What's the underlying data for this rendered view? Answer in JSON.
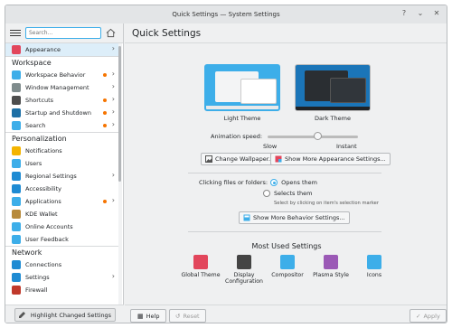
{
  "window": {
    "title": "Quick Settings — System Settings"
  },
  "toolbar": {
    "search_placeholder": "Search..."
  },
  "sidebar": {
    "items": [
      {
        "type": "item",
        "label": "Appearance",
        "icon": "appearance-icon",
        "color": "#e2465c",
        "chevron": true,
        "dot": false
      },
      {
        "type": "section",
        "label": "Workspace"
      },
      {
        "type": "item",
        "label": "Workspace Behavior",
        "icon": "workspace-icon",
        "color": "#3daee9",
        "chevron": true,
        "dot": true
      },
      {
        "type": "item",
        "label": "Window Management",
        "icon": "window-icon",
        "color": "#7f8c8d",
        "chevron": true,
        "dot": false
      },
      {
        "type": "item",
        "label": "Shortcuts",
        "icon": "keyboard-icon",
        "color": "#4d4d4d",
        "chevron": true,
        "dot": true
      },
      {
        "type": "item",
        "label": "Startup and Shutdown",
        "icon": "startup-icon",
        "color": "#1d6fa5",
        "chevron": true,
        "dot": true
      },
      {
        "type": "item",
        "label": "Search",
        "icon": "search-icon",
        "color": "#3daee9",
        "chevron": true,
        "dot": true
      },
      {
        "type": "section",
        "label": "Personalization"
      },
      {
        "type": "item",
        "label": "Notifications",
        "icon": "bell-icon",
        "color": "#f4b400",
        "chevron": false,
        "dot": false
      },
      {
        "type": "item",
        "label": "Users",
        "icon": "users-icon",
        "color": "#3daee9",
        "chevron": false,
        "dot": false
      },
      {
        "type": "item",
        "label": "Regional Settings",
        "icon": "regional-icon",
        "color": "#1e8bd3",
        "chevron": true,
        "dot": false
      },
      {
        "type": "item",
        "label": "Accessibility",
        "icon": "accessibility-icon",
        "color": "#1e8bd3",
        "chevron": false,
        "dot": false
      },
      {
        "type": "item",
        "label": "Applications",
        "icon": "applications-icon",
        "color": "#3daee9",
        "chevron": true,
        "dot": true
      },
      {
        "type": "item",
        "label": "KDE Wallet",
        "icon": "wallet-icon",
        "color": "#b78a3b",
        "chevron": false,
        "dot": false
      },
      {
        "type": "item",
        "label": "Online Accounts",
        "icon": "accounts-icon",
        "color": "#3daee9",
        "chevron": false,
        "dot": false
      },
      {
        "type": "item",
        "label": "User Feedback",
        "icon": "feedback-icon",
        "color": "#3daee9",
        "chevron": false,
        "dot": false
      },
      {
        "type": "section",
        "label": "Network"
      },
      {
        "type": "item",
        "label": "Connections",
        "icon": "connections-icon",
        "color": "#1e8bd3",
        "chevron": false,
        "dot": false
      },
      {
        "type": "item",
        "label": "Settings",
        "icon": "network-settings-icon",
        "color": "#1e8bd3",
        "chevron": true,
        "dot": false
      },
      {
        "type": "item",
        "label": "Firewall",
        "icon": "firewall-icon",
        "color": "#c0392b",
        "chevron": false,
        "dot": false
      }
    ],
    "highlight_label": "Highlight Changed Settings"
  },
  "main": {
    "title": "Quick Settings",
    "themes": [
      {
        "label": "Light Theme",
        "selected": true
      },
      {
        "label": "Dark Theme",
        "selected": false
      }
    ],
    "animation": {
      "label": "Animation speed:",
      "slow": "Slow",
      "instant": "Instant",
      "value": 0.55
    },
    "change_wallpaper": "Change Wallpaper...",
    "more_appearance": "Show More Appearance Settings...",
    "click_label": "Clicking files or folders:",
    "click_options": [
      "Opens them",
      "Selects them"
    ],
    "click_hint": "Select by clicking on item's selection marker",
    "more_behavior": "Show More Behavior Settings...",
    "most_used_title": "Most Used Settings",
    "most_used": [
      {
        "label": "Global Theme",
        "icon": "global-theme-icon",
        "color": "#e2465c"
      },
      {
        "label": "Display Configuration",
        "icon": "display-icon",
        "color": "#444"
      },
      {
        "label": "Compositor",
        "icon": "compositor-icon",
        "color": "#3daee9"
      },
      {
        "label": "Plasma Style",
        "icon": "plasma-style-icon",
        "color": "#9b59b6"
      },
      {
        "label": "Icons",
        "icon": "icons-icon",
        "color": "#3daee9"
      }
    ]
  },
  "footer": {
    "help": "Help",
    "reset": "Reset",
    "apply": "Apply"
  }
}
